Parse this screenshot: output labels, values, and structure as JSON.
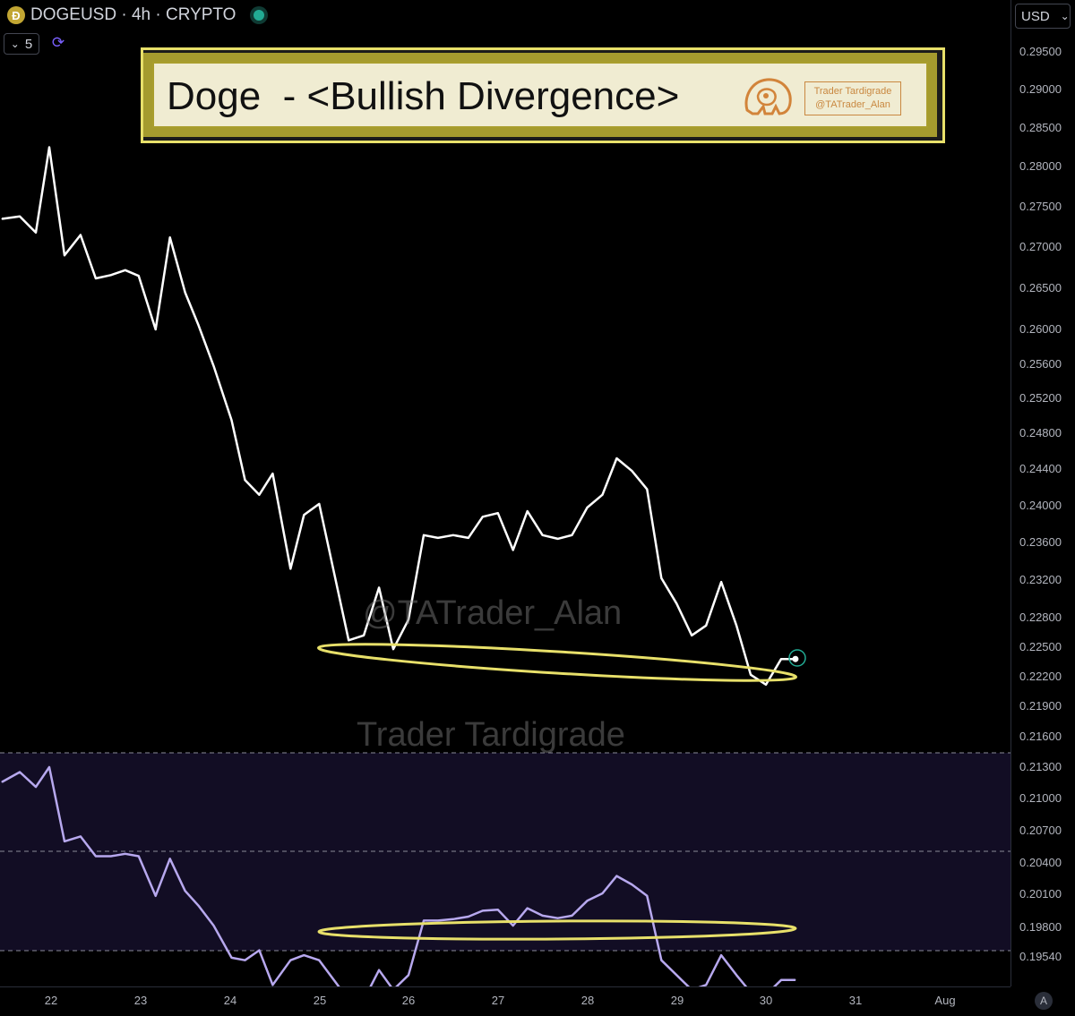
{
  "header": {
    "coin_glyph": "Ð",
    "symbol": "DOGEUSD · 4h · CRYPTO",
    "indicator_count": "5",
    "currency": "USD",
    "auto_label": "A"
  },
  "banner": {
    "title": "Doge  - <Bullish Divergence>",
    "badge_line1": "Trader Tardigrade",
    "badge_line2": "@TATrader_Alan"
  },
  "watermarks": {
    "handle": "@TATrader_Alan",
    "name": "Trader Tardigrade"
  },
  "colors": {
    "price_line": "#ffffff",
    "rsi_line": "#b7a8ee",
    "rsi_band": "#120d24",
    "highlight": "#e8e06a"
  },
  "chart_data": {
    "type": "line",
    "title": "",
    "x_tick_labels": [
      "22",
      "23",
      "24",
      "25",
      "26",
      "27",
      "28",
      "29",
      "30",
      "31",
      "Aug"
    ],
    "y_tick_labels": [
      "0.29500",
      "0.29000",
      "0.28500",
      "0.28000",
      "0.27500",
      "0.27000",
      "0.26500",
      "0.26000",
      "0.25600",
      "0.25200",
      "0.24800",
      "0.24400",
      "0.24000",
      "0.23600",
      "0.23200",
      "0.22800",
      "0.22500",
      "0.22200",
      "0.21900",
      "0.21600",
      "0.21300",
      "0.21000",
      "0.20700",
      "0.20400",
      "0.20100",
      "0.19800",
      "0.19540"
    ],
    "price_series": {
      "x": [
        21.45,
        21.65,
        21.83,
        21.98,
        22.15,
        22.33,
        22.5,
        22.67,
        22.83,
        22.98,
        23.17,
        23.33,
        23.5,
        23.65,
        23.82,
        24.02,
        24.17,
        24.33,
        24.48,
        24.68,
        24.83,
        25.0,
        25.33,
        25.5,
        25.67,
        25.83,
        26.0,
        26.17,
        26.33,
        26.5,
        26.67,
        26.83,
        27.0,
        27.17,
        27.33,
        27.5,
        27.67,
        27.83,
        28.0,
        28.17,
        28.33,
        28.5,
        28.67,
        28.83,
        29.0,
        29.17,
        29.33,
        29.5,
        29.67,
        29.83,
        30.0,
        30.17,
        30.33
      ],
      "values": [
        0.2735,
        0.2738,
        0.2718,
        0.2825,
        0.269,
        0.2715,
        0.2662,
        0.2666,
        0.2672,
        0.2665,
        0.26,
        0.2712,
        0.2645,
        0.2605,
        0.2558,
        0.2495,
        0.2428,
        0.2412,
        0.2435,
        0.2332,
        0.239,
        0.2402,
        0.2257,
        0.2262,
        0.2312,
        0.2248,
        0.2278,
        0.2368,
        0.2365,
        0.2368,
        0.2365,
        0.2388,
        0.2392,
        0.2352,
        0.2394,
        0.2368,
        0.2364,
        0.2368,
        0.2398,
        0.2412,
        0.2452,
        0.2438,
        0.2418,
        0.2322,
        0.2295,
        0.2262,
        0.2272,
        0.2318,
        0.2272,
        0.2222,
        0.2212,
        0.2238,
        0.2238
      ]
    },
    "rsi_series": {
      "x": [
        21.45,
        21.65,
        21.83,
        21.98,
        22.15,
        22.33,
        22.5,
        22.67,
        22.83,
        22.98,
        23.17,
        23.33,
        23.5,
        23.65,
        23.82,
        24.02,
        24.17,
        24.33,
        24.48,
        24.68,
        24.83,
        25.0,
        25.33,
        25.5,
        25.67,
        25.83,
        26.0,
        26.17,
        26.33,
        26.5,
        26.67,
        26.83,
        27.0,
        27.17,
        27.33,
        27.5,
        27.67,
        27.83,
        28.0,
        28.17,
        28.33,
        28.5,
        28.67,
        28.83,
        29.0,
        29.17,
        29.33,
        29.5,
        29.67,
        29.83,
        30.0,
        30.17,
        30.33
      ],
      "values": [
        64,
        66,
        63,
        67,
        52,
        53,
        49,
        49,
        49.5,
        49,
        41,
        48.5,
        42,
        39,
        35,
        28.5,
        28,
        30,
        23,
        28,
        29,
        28,
        20,
        20,
        26,
        22,
        25,
        36,
        36,
        36.3,
        36.8,
        38,
        38.2,
        35,
        38.5,
        37,
        36.5,
        37,
        40,
        41.5,
        45,
        43.3,
        41,
        28,
        25,
        22,
        23,
        29,
        25,
        21.5,
        21,
        24,
        24
      ]
    },
    "rsi_levels": [
      70,
      50,
      30
    ],
    "divergence_highlights": [
      "price lower low",
      "rsi higher low"
    ]
  }
}
